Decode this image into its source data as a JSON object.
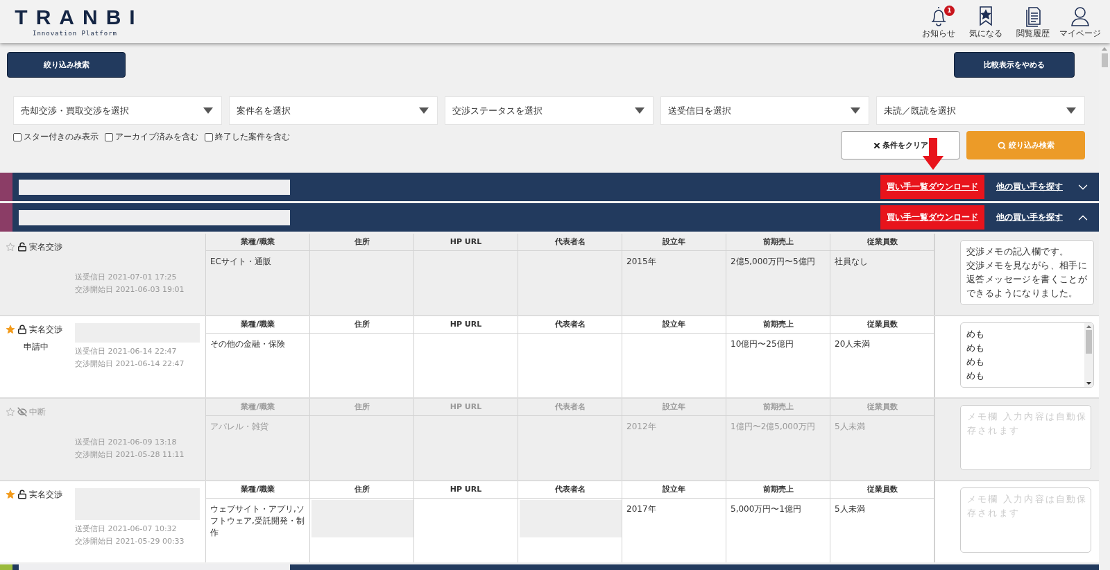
{
  "header": {
    "logo": "TRANBI",
    "tagline": "Innovation Platform",
    "nav": [
      {
        "kind": "bell",
        "label": "お知らせ",
        "badge": "1"
      },
      {
        "kind": "bookmark",
        "label": "気になる"
      },
      {
        "kind": "history",
        "label": "閲覧履歴"
      },
      {
        "kind": "user",
        "label": "マイページ"
      }
    ]
  },
  "toolbar": {
    "filter_button": "絞り込み検索",
    "compare_button": "比較表示をやめる"
  },
  "filters": {
    "dropdowns": [
      {
        "placeholder": "売却交渉・買取交渉を選択"
      },
      {
        "placeholder": "案件名を選択"
      },
      {
        "placeholder": "交渉ステータスを選択"
      },
      {
        "placeholder": "送受信日を選択"
      },
      {
        "placeholder": "未読／既読を選択"
      }
    ],
    "checkboxes": [
      {
        "label": "スター付きのみ表示",
        "checked": false
      },
      {
        "label": "アーカイブ済みを含む",
        "checked": false
      },
      {
        "label": "終了した案件を含む",
        "checked": false
      }
    ],
    "clear_button": "条件をクリア",
    "search_button": "絞り込み検索",
    "annotation_arrow": true
  },
  "groups": [
    {
      "color": "#8b3d66",
      "title_redacted": true,
      "download_link": {
        "label": "買い手一覧ダウンロード",
        "highlighted": true
      },
      "search_link": "他の買い手を探す",
      "expanded": false
    },
    {
      "color": "#8b3d66",
      "title_redacted": true,
      "download_link": {
        "label": "買い手一覧ダウンロード",
        "highlighted": true
      },
      "search_link": "他の買い手を探す",
      "expanded": true,
      "rows": [
        {
          "starred": false,
          "locked": false,
          "hidden": false,
          "status": "実名交渉",
          "name_redacted": false,
          "shaded": true,
          "dimmed": false,
          "sent_date": "送受信日 2021-07-01 17:25",
          "start_date": "交渉開始日 2021-06-03 19:01",
          "headers": [
            "業種/職業",
            "住所",
            "HP URL",
            "代表者名",
            "設立年",
            "前期売上",
            "従業員数"
          ],
          "cells": [
            "ECサイト・通販",
            "",
            "",
            "",
            "2015年",
            "2億5,000万円〜5億円",
            "社員なし"
          ],
          "memo": {
            "lines": [
              "交渉メモの記入欄です。",
              "交渉メモを見ながら、相手に返答メッセージを書くことができるようになりました。"
            ],
            "scrollbar": false
          }
        },
        {
          "starred": true,
          "locked": true,
          "hidden": false,
          "status": "実名交渉",
          "sub_status": "申請中",
          "name_redacted": true,
          "shaded": false,
          "dimmed": false,
          "sent_date": "送受信日 2021-06-14 22:47",
          "start_date": "交渉開始日 2021-06-14 22:47",
          "headers": [
            "業種/職業",
            "住所",
            "HP URL",
            "代表者名",
            "設立年",
            "前期売上",
            "従業員数"
          ],
          "cells": [
            "その他の金融・保険",
            "",
            "",
            "",
            "",
            "10億円〜25億円",
            "20人未満"
          ],
          "memo": {
            "lines": [
              "めも",
              "めも",
              "めも",
              "めも"
            ],
            "scrollbar": true
          }
        },
        {
          "starred": false,
          "hidden": true,
          "status": "中断",
          "name_redacted": false,
          "shaded": true,
          "dimmed": true,
          "sent_date": "送受信日 2021-06-09 13:18",
          "start_date": "交渉開始日 2021-05-28 11:11",
          "headers": [
            "業種/職業",
            "住所",
            "HP URL",
            "代表者名",
            "設立年",
            "前期売上",
            "従業員数"
          ],
          "cells": [
            "アパレル・雑貨",
            "",
            "",
            "",
            "2012年",
            "1億円〜2億5,000万円",
            "5人未満"
          ],
          "memo": {
            "placeholder": "メモ欄 入力内容は自動保存されます"
          }
        },
        {
          "starred": true,
          "locked": false,
          "hidden": false,
          "status": "実名交渉",
          "name_redacted": true,
          "shaded": false,
          "dimmed": false,
          "sent_date": "送受信日 2021-06-07 10:32",
          "start_date": "交渉開始日 2021-05-29 00:33",
          "headers": [
            "業種/職業",
            "住所",
            "HP URL",
            "代表者名",
            "設立年",
            "前期売上",
            "従業員数"
          ],
          "cells": [
            "ウェブサイト・アプリ,ソフトウェア,受託開発・制作",
            {
              "redacted": true
            },
            "",
            {
              "redacted": true
            },
            "2017年",
            "5,000万円〜1億円",
            "5人未満"
          ],
          "memo": {
            "placeholder": "メモ欄 入力内容は自動保存されます"
          }
        }
      ]
    },
    {
      "color": "#9bbb3c",
      "title_redacted": true
    }
  ]
}
